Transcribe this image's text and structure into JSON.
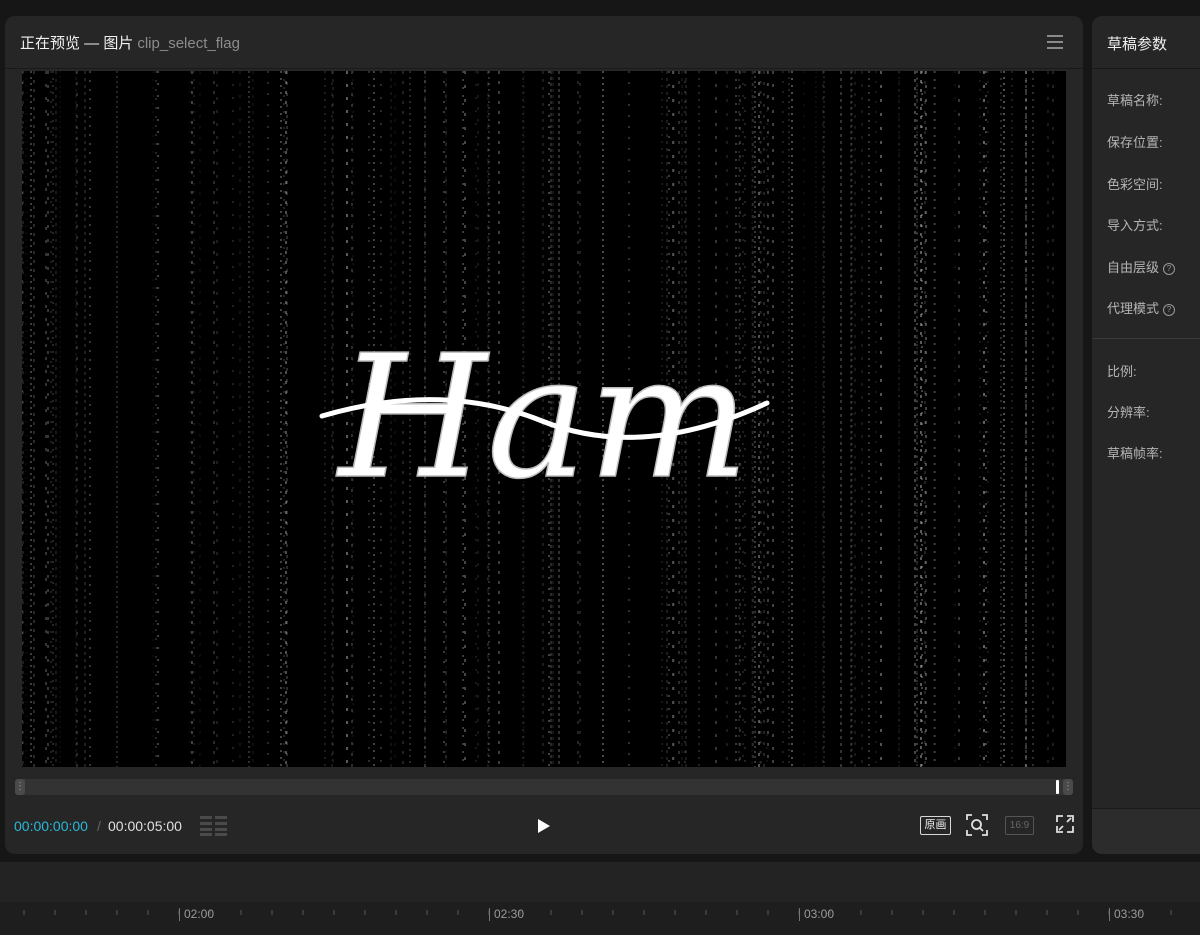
{
  "preview": {
    "title": "正在预览 — 图片",
    "clip_name": "clip_select_flag",
    "content_text": "Ham",
    "timecode_current": "00:00:00:00",
    "timecode_separator": "/",
    "timecode_total": "00:00:05:00",
    "original_button": "原画",
    "ratio_button": "16:9"
  },
  "params": {
    "title": "草稿参数",
    "fields": [
      {
        "label": "草稿名称:"
      },
      {
        "label": "保存位置:"
      },
      {
        "label": "色彩空间:"
      },
      {
        "label": "导入方式:"
      },
      {
        "label": "自由层级"
      },
      {
        "label": "代理模式"
      },
      {
        "label": "比例:"
      },
      {
        "label": "分辨率:"
      },
      {
        "label": "草稿帧率:"
      }
    ]
  },
  "timeline": {
    "ticks": [
      "02:00",
      "02:30",
      "03:00",
      "03:30"
    ]
  },
  "colors": {
    "accent": "#29b8d6",
    "panel_bg": "#262626",
    "app_bg": "#161616"
  }
}
